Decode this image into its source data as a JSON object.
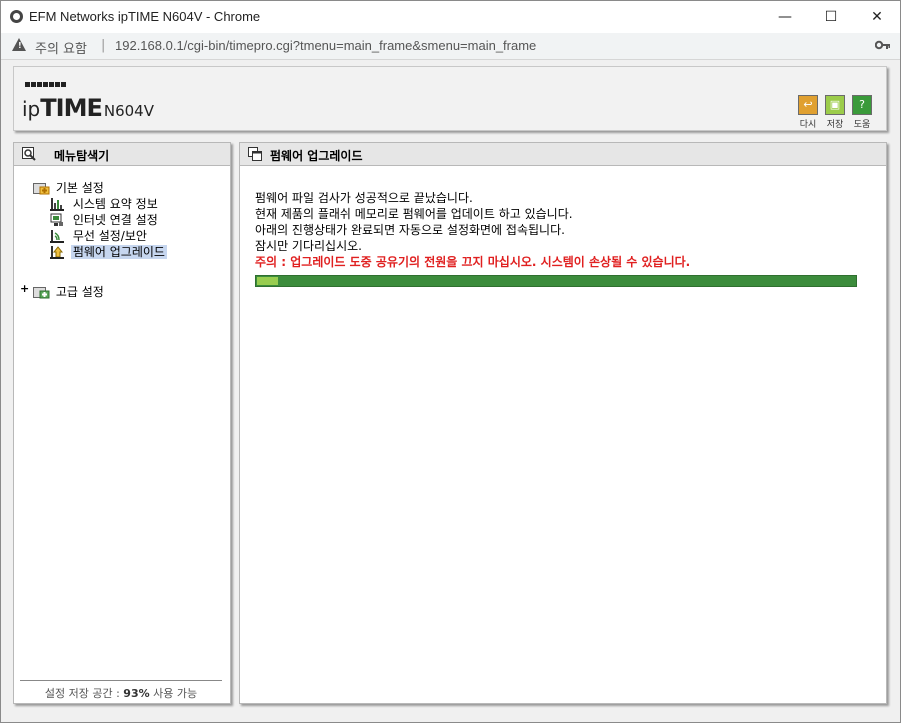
{
  "window": {
    "title": "EFM Networks ipTIME N604V - Chrome",
    "minimize": "—",
    "maximize": "☐",
    "close": "✕"
  },
  "addressbar": {
    "security_label": "주의 요함",
    "separator": "|",
    "url": "192.168.0.1/cgi-bin/timepro.cgi?tmenu=main_frame&smenu=main_frame"
  },
  "header": {
    "logo_ip": "ip",
    "logo_time": "TIME",
    "model": "N604V",
    "tools": [
      {
        "label": "다시",
        "icon": "undo-icon",
        "color": "#e0a030"
      },
      {
        "label": "저장",
        "icon": "save-icon",
        "color": "#9ccc4a"
      },
      {
        "label": "도움",
        "icon": "help-icon",
        "color": "#3a9a3a"
      }
    ]
  },
  "sidebar": {
    "title": "메뉴탐색기",
    "groups": [
      {
        "label": "기본 설정",
        "items": [
          {
            "label": "시스템 요약 정보",
            "icon": "bar-chart-icon"
          },
          {
            "label": "인터넷 연결 설정",
            "icon": "monitor-icon"
          },
          {
            "label": "무선 설정/보안",
            "icon": "wireless-icon"
          },
          {
            "label": "펌웨어 업그레이드",
            "icon": "upgrade-icon",
            "selected": true
          }
        ]
      },
      {
        "label": "고급 설정",
        "expander": "+"
      }
    ],
    "storage": {
      "prefix": "설정 저장 공간 :",
      "value": "93%",
      "suffix": "사용 가능"
    }
  },
  "main": {
    "title": "펌웨어 업그레이드",
    "messages": [
      "펌웨어 파일 검사가 성공적으로 끝났습니다.",
      "현재 제품의 플래쉬 메모리로 펌웨어를 업데이트 하고 있습니다.",
      "아래의 진행상태가 완료되면 자동으로 설정화면에 접속됩니다.",
      "잠시만 기다리십시오."
    ],
    "warning": "주의 : 업그레이드 도중 공유기의 전원을 끄지 마십시오. 시스템이 손상될 수 있습니다.",
    "progress": 0.035
  }
}
